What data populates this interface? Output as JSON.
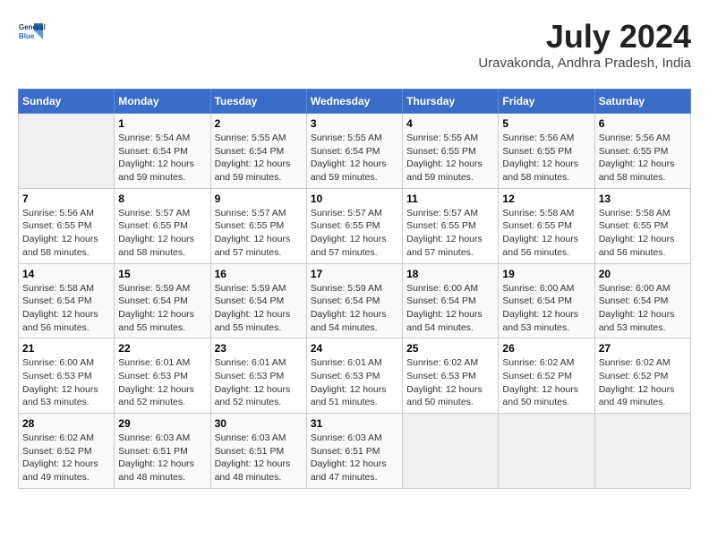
{
  "logo": {
    "line1": "General",
    "line2": "Blue"
  },
  "title": "July 2024",
  "location": "Uravakonda, Andhra Pradesh, India",
  "header": {
    "days": [
      "Sunday",
      "Monday",
      "Tuesday",
      "Wednesday",
      "Thursday",
      "Friday",
      "Saturday"
    ]
  },
  "weeks": [
    {
      "cells": [
        {
          "day": "",
          "info": ""
        },
        {
          "day": "1",
          "info": "Sunrise: 5:54 AM\nSunset: 6:54 PM\nDaylight: 12 hours\nand 59 minutes."
        },
        {
          "day": "2",
          "info": "Sunrise: 5:55 AM\nSunset: 6:54 PM\nDaylight: 12 hours\nand 59 minutes."
        },
        {
          "day": "3",
          "info": "Sunrise: 5:55 AM\nSunset: 6:54 PM\nDaylight: 12 hours\nand 59 minutes."
        },
        {
          "day": "4",
          "info": "Sunrise: 5:55 AM\nSunset: 6:55 PM\nDaylight: 12 hours\nand 59 minutes."
        },
        {
          "day": "5",
          "info": "Sunrise: 5:56 AM\nSunset: 6:55 PM\nDaylight: 12 hours\nand 58 minutes."
        },
        {
          "day": "6",
          "info": "Sunrise: 5:56 AM\nSunset: 6:55 PM\nDaylight: 12 hours\nand 58 minutes."
        }
      ]
    },
    {
      "cells": [
        {
          "day": "7",
          "info": "Sunrise: 5:56 AM\nSunset: 6:55 PM\nDaylight: 12 hours\nand 58 minutes."
        },
        {
          "day": "8",
          "info": "Sunrise: 5:57 AM\nSunset: 6:55 PM\nDaylight: 12 hours\nand 58 minutes."
        },
        {
          "day": "9",
          "info": "Sunrise: 5:57 AM\nSunset: 6:55 PM\nDaylight: 12 hours\nand 57 minutes."
        },
        {
          "day": "10",
          "info": "Sunrise: 5:57 AM\nSunset: 6:55 PM\nDaylight: 12 hours\nand 57 minutes."
        },
        {
          "day": "11",
          "info": "Sunrise: 5:57 AM\nSunset: 6:55 PM\nDaylight: 12 hours\nand 57 minutes."
        },
        {
          "day": "12",
          "info": "Sunrise: 5:58 AM\nSunset: 6:55 PM\nDaylight: 12 hours\nand 56 minutes."
        },
        {
          "day": "13",
          "info": "Sunrise: 5:58 AM\nSunset: 6:55 PM\nDaylight: 12 hours\nand 56 minutes."
        }
      ]
    },
    {
      "cells": [
        {
          "day": "14",
          "info": "Sunrise: 5:58 AM\nSunset: 6:54 PM\nDaylight: 12 hours\nand 56 minutes."
        },
        {
          "day": "15",
          "info": "Sunrise: 5:59 AM\nSunset: 6:54 PM\nDaylight: 12 hours\nand 55 minutes."
        },
        {
          "day": "16",
          "info": "Sunrise: 5:59 AM\nSunset: 6:54 PM\nDaylight: 12 hours\nand 55 minutes."
        },
        {
          "day": "17",
          "info": "Sunrise: 5:59 AM\nSunset: 6:54 PM\nDaylight: 12 hours\nand 54 minutes."
        },
        {
          "day": "18",
          "info": "Sunrise: 6:00 AM\nSunset: 6:54 PM\nDaylight: 12 hours\nand 54 minutes."
        },
        {
          "day": "19",
          "info": "Sunrise: 6:00 AM\nSunset: 6:54 PM\nDaylight: 12 hours\nand 53 minutes."
        },
        {
          "day": "20",
          "info": "Sunrise: 6:00 AM\nSunset: 6:54 PM\nDaylight: 12 hours\nand 53 minutes."
        }
      ]
    },
    {
      "cells": [
        {
          "day": "21",
          "info": "Sunrise: 6:00 AM\nSunset: 6:53 PM\nDaylight: 12 hours\nand 53 minutes."
        },
        {
          "day": "22",
          "info": "Sunrise: 6:01 AM\nSunset: 6:53 PM\nDaylight: 12 hours\nand 52 minutes."
        },
        {
          "day": "23",
          "info": "Sunrise: 6:01 AM\nSunset: 6:53 PM\nDaylight: 12 hours\nand 52 minutes."
        },
        {
          "day": "24",
          "info": "Sunrise: 6:01 AM\nSunset: 6:53 PM\nDaylight: 12 hours\nand 51 minutes."
        },
        {
          "day": "25",
          "info": "Sunrise: 6:02 AM\nSunset: 6:53 PM\nDaylight: 12 hours\nand 50 minutes."
        },
        {
          "day": "26",
          "info": "Sunrise: 6:02 AM\nSunset: 6:52 PM\nDaylight: 12 hours\nand 50 minutes."
        },
        {
          "day": "27",
          "info": "Sunrise: 6:02 AM\nSunset: 6:52 PM\nDaylight: 12 hours\nand 49 minutes."
        }
      ]
    },
    {
      "cells": [
        {
          "day": "28",
          "info": "Sunrise: 6:02 AM\nSunset: 6:52 PM\nDaylight: 12 hours\nand 49 minutes."
        },
        {
          "day": "29",
          "info": "Sunrise: 6:03 AM\nSunset: 6:51 PM\nDaylight: 12 hours\nand 48 minutes."
        },
        {
          "day": "30",
          "info": "Sunrise: 6:03 AM\nSunset: 6:51 PM\nDaylight: 12 hours\nand 48 minutes."
        },
        {
          "day": "31",
          "info": "Sunrise: 6:03 AM\nSunset: 6:51 PM\nDaylight: 12 hours\nand 47 minutes."
        },
        {
          "day": "",
          "info": ""
        },
        {
          "day": "",
          "info": ""
        },
        {
          "day": "",
          "info": ""
        }
      ]
    }
  ]
}
